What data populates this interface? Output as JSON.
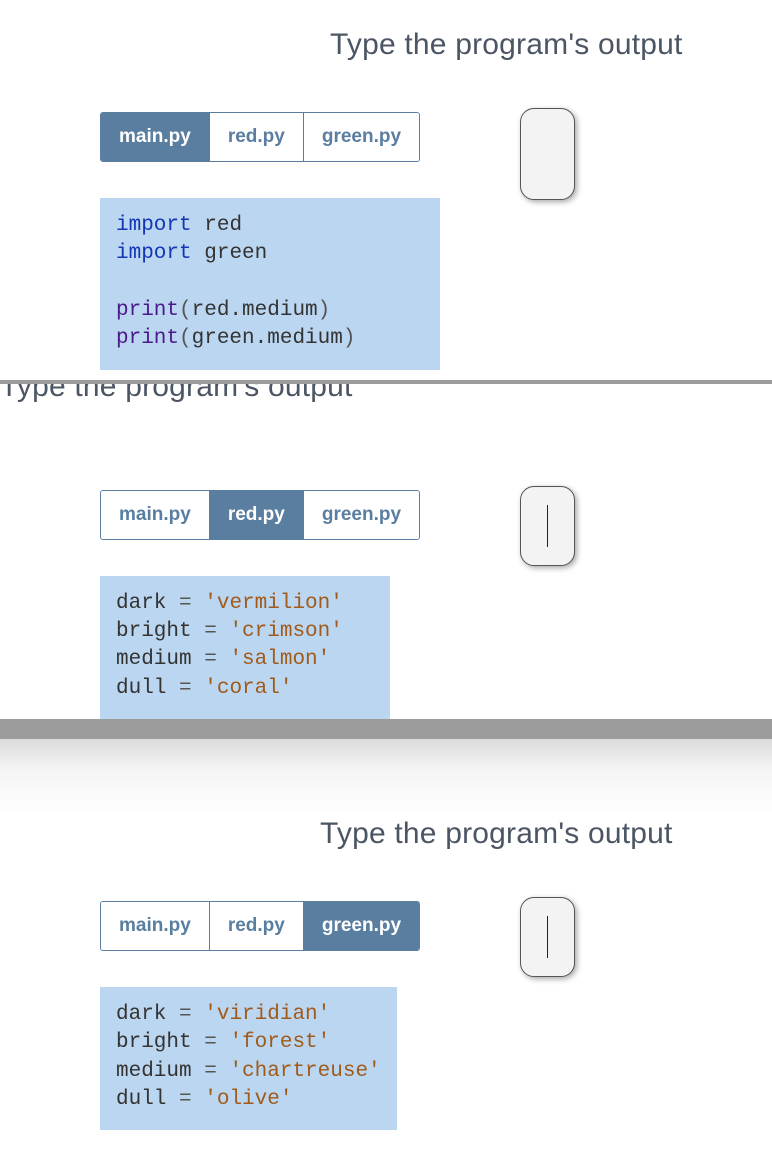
{
  "common": {
    "heading": "Type the program's output"
  },
  "panel1": {
    "tabs": {
      "main": "main.py",
      "red": "red.py",
      "green": "green.py",
      "activeIndex": 0
    },
    "code": {
      "kw_import": "import",
      "mod_red": "red",
      "mod_green": "green",
      "fn_print": "print",
      "expr_red": "red.medium",
      "expr_green": "green.medium"
    },
    "output": ""
  },
  "panel2": {
    "tabs": {
      "main": "main.py",
      "red": "red.py",
      "green": "green.py",
      "activeIndex": 1
    },
    "code": {
      "v_dark": "dark",
      "s_dark": "'vermilion'",
      "v_bright": "bright",
      "s_bright": "'crimson'",
      "v_medium": "medium",
      "s_medium": "'salmon'",
      "v_dull": "dull",
      "s_dull": "'coral'",
      "eq": " = "
    },
    "output": ""
  },
  "panel3": {
    "tabs": {
      "main": "main.py",
      "red": "red.py",
      "green": "green.py",
      "activeIndex": 2
    },
    "code": {
      "v_dark": "dark",
      "s_dark": "'viridian'",
      "v_bright": "bright",
      "s_bright": "'forest'",
      "v_medium": "medium",
      "s_medium": "'chartreuse'",
      "v_dull": "dull",
      "s_dull": "'olive'",
      "eq": " = "
    },
    "output": ""
  }
}
